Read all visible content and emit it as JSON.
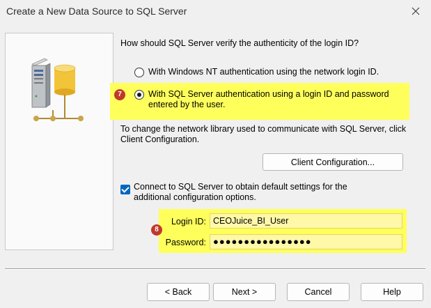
{
  "window": {
    "title": "Create a New Data Source to SQL Server"
  },
  "main": {
    "question": "How should SQL Server verify the authenticity of the login ID?",
    "auth_options": [
      {
        "label": "With Windows NT authentication using the network login ID.",
        "selected": false
      },
      {
        "label": "With SQL Server authentication using a login ID and password entered by the user.",
        "selected": true
      }
    ],
    "network_note": "To change the network library used to communicate with SQL Server, click Client Configuration.",
    "client_config_label": "Client Configuration...",
    "connect_checkbox": {
      "label": "Connect to SQL Server to obtain default settings for the additional configuration options.",
      "checked": true
    },
    "login": {
      "label": "Login ID:",
      "value": "CEOJuice_BI_User"
    },
    "password": {
      "label": "Password:",
      "value": "●●●●●●●●●●●●●●●●"
    }
  },
  "annotations": {
    "step7": "7",
    "step8": "8",
    "highlight_color": "#ffff5c"
  },
  "buttons": {
    "back": "< Back",
    "next": "Next >",
    "cancel": "Cancel",
    "help": "Help"
  },
  "icons": {
    "close": "close-icon",
    "server": "database-server-icon"
  }
}
